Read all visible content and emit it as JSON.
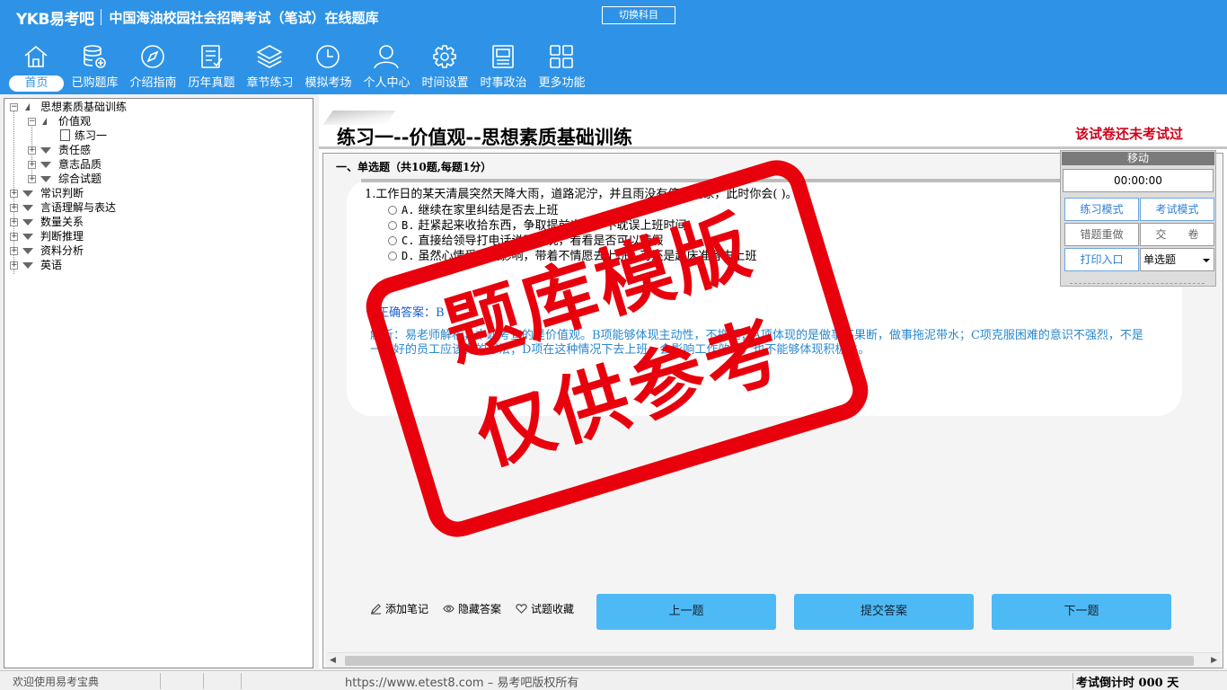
{
  "header": {
    "logo": "YKB易考吧",
    "title": "中国海油校园社会招聘考试（笔试）在线题库",
    "switch_subject": "切换科目"
  },
  "nav": [
    {
      "label": "首页",
      "icon": "home-icon"
    },
    {
      "label": "已购题库",
      "icon": "database-icon"
    },
    {
      "label": "介绍指南",
      "icon": "compass-icon"
    },
    {
      "label": "历年真题",
      "icon": "document-list-icon"
    },
    {
      "label": "章节练习",
      "icon": "layers-icon"
    },
    {
      "label": "模拟考场",
      "icon": "clock-icon"
    },
    {
      "label": "个人中心",
      "icon": "user-icon"
    },
    {
      "label": "时间设置",
      "icon": "gear-icon"
    },
    {
      "label": "时事政治",
      "icon": "newspaper-icon"
    },
    {
      "label": "更多功能",
      "icon": "grid-icon"
    }
  ],
  "tree": [
    {
      "label": "思想素质基础训练"
    },
    {
      "label": "价值观"
    },
    {
      "label": "练习一"
    },
    {
      "label": "责任感"
    },
    {
      "label": "意志品质"
    },
    {
      "label": "综合试题"
    },
    {
      "label": "常识判断"
    },
    {
      "label": "言语理解与表达"
    },
    {
      "label": "数量关系"
    },
    {
      "label": "判断推理"
    },
    {
      "label": "资料分析"
    },
    {
      "label": "英语"
    }
  ],
  "exam": {
    "title": "练习一--价值观--思想素质基础训练",
    "status": "该试卷还未考试过",
    "section": "一、单选题（共10题,每题1分）",
    "question": "1.工作日的某天清晨突然天降大雨，道路泥泞，并且雨没有停的迹象，此时你会(  )。",
    "options": [
      {
        "letter": "A.",
        "text": "继续在家里纠结是否去上班"
      },
      {
        "letter": "B.",
        "text": "赶紧起来收拾东西，争取提前出门，不耽误上班时间"
      },
      {
        "letter": "C.",
        "text": "直接给领导打电话说明情况，看看是否可以请假"
      },
      {
        "letter": "D.",
        "text": "虽然心情受天气影响，带着不情愿去上班，可还是起床准备去上班"
      }
    ],
    "answer": "正确答案：B",
    "analysis": "解析：易老师解析，本题考查的是价值观。B项能够体现主动性，不拖延；A项体现的是做事不果断，做事拖泥带水；C项克服困难的意识不强烈，不是一个好的员工应该有的想法；D项在这种情况下去上班，会影响工作效率，也不能够体现积极性。"
  },
  "tools": [
    {
      "label": "添加笔记",
      "icon": "pencil-icon"
    },
    {
      "label": "隐藏答案",
      "icon": "eye-icon"
    },
    {
      "label": "试题收藏",
      "icon": "heart-icon"
    }
  ],
  "buttons": {
    "prev": "上一题",
    "submit": "提交答案",
    "next": "下一题"
  },
  "panel": {
    "move": "移动",
    "timer": "00:00:00",
    "practice_mode": "练习模式",
    "exam_mode": "考试模式",
    "redo_wrong": "错题重做",
    "hand_in": "交　　卷",
    "print": "打印入口",
    "type_select": "单选题"
  },
  "status": {
    "welcome": "欢迎使用易考宝典",
    "copyright": "https://www.etest8.com – 易考吧版权所有",
    "countdown": "考试倒计时 000 天"
  },
  "watermark": {
    "line1": "题库模版",
    "line2": "仅供参考"
  },
  "colors": {
    "header": "#2e93e6",
    "primary_button": "#4dbaf5",
    "stamp": "#e8000d",
    "status_red": "#d0021b"
  }
}
